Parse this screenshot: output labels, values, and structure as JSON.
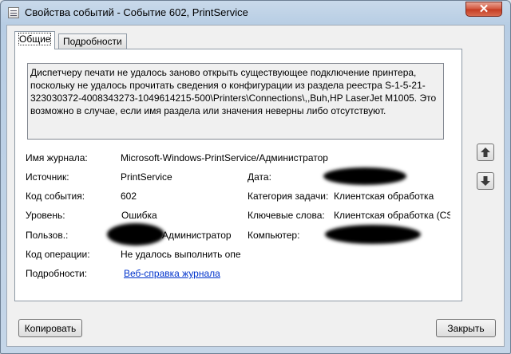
{
  "window": {
    "title": "Свойства событий - Событие 602, PrintService",
    "close_label": "✕"
  },
  "tabs": [
    {
      "label": "Общие",
      "active": true
    },
    {
      "label": "Подробности",
      "active": false
    }
  ],
  "message": "Диспетчеру печати не удалось заново открыть существующее подключение принтера, поскольку не удалось прочитать сведения о конфигурации из раздела реестра S-1-5-21-323030372-4008343273-1049614215-500\\Printers\\Connections\\,,Buh,HP LaserJet M1005. Это возможно в случае, если имя раздела или значения неверны либо отсутствуют.",
  "fields": {
    "log_name": {
      "label": "Имя журнала:",
      "value": "Microsoft-Windows-PrintService/Администратор"
    },
    "source": {
      "label": "Источник:",
      "value": "PrintService"
    },
    "date": {
      "label": "Дата:"
    },
    "event_id": {
      "label": "Код события:",
      "value": "602"
    },
    "task_category": {
      "label": "Категория задачи:",
      "value": "Клиентская обработка"
    },
    "level": {
      "label": "Уровень:",
      "value": "Ошибка"
    },
    "keywords": {
      "label": "Ключевые слова:",
      "value": "Клиентская обработка (CS"
    },
    "user": {
      "label": "Пользов.:",
      "value": "Администратор"
    },
    "computer": {
      "label": "Компьютер:"
    },
    "opcode": {
      "label": "Код операции:",
      "value": "Не удалось выполнить опе"
    },
    "details": {
      "label": "Подробности:",
      "value": "Веб-справка журнала"
    }
  },
  "buttons": {
    "copy": "Копировать",
    "close": "Закрыть"
  },
  "icons": {
    "app": "event-viewer-icon",
    "up": "arrow-up-icon",
    "down": "arrow-down-icon"
  }
}
